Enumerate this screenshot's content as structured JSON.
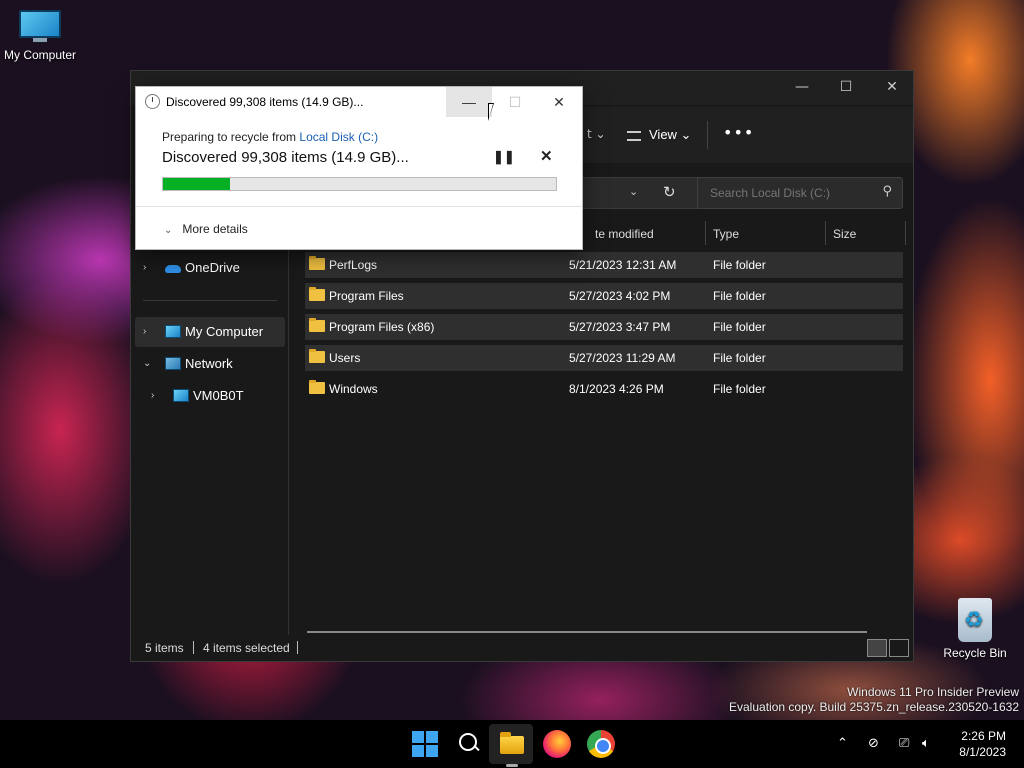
{
  "desktop": {
    "icons": [
      {
        "label": "My Computer",
        "icon": "computer-icon"
      },
      {
        "label": "Recycle Bin",
        "icon": "recycle-bin-icon"
      }
    ],
    "watermark": {
      "line1": "Windows 11 Pro Insider Preview",
      "line2": "Evaluation copy. Build 25375.zn_release.230520-1632"
    }
  },
  "explorer": {
    "toolbar": {
      "partial": "t ⌄",
      "view_label": "View ⌄",
      "more_label": "•••"
    },
    "search": {
      "placeholder": "Search Local Disk (C:)"
    },
    "columns": {
      "date": "te modified",
      "type": "Type",
      "size": "Size"
    },
    "nav": [
      {
        "label": "OneDrive",
        "chevron": "›",
        "icon": "onedrive-icon"
      },
      {
        "label": "My Computer",
        "chevron": "›",
        "icon": "computer-icon",
        "selected": true
      },
      {
        "label": "Network",
        "chevron": "⌄",
        "icon": "network-icon"
      },
      {
        "label": "VM0B0T",
        "chevron": "›",
        "icon": "computer-icon"
      }
    ],
    "files": [
      {
        "name": "PerfLogs",
        "date": "5/21/2023 12:31 AM",
        "type": "File folder",
        "selected": true
      },
      {
        "name": "Program Files",
        "date": "5/27/2023 4:02 PM",
        "type": "File folder",
        "selected": true
      },
      {
        "name": "Program Files (x86)",
        "date": "5/27/2023 3:47 PM",
        "type": "File folder",
        "selected": true
      },
      {
        "name": "Users",
        "date": "5/27/2023 11:29 AM",
        "type": "File folder",
        "selected": true
      },
      {
        "name": "Windows",
        "date": "8/1/2023 4:26 PM",
        "type": "File folder",
        "selected": false
      }
    ],
    "status": {
      "count": "5 items",
      "selected": "4 items selected"
    },
    "window_controls": {
      "minimize": "—",
      "maximize": "☐",
      "close": "✕"
    }
  },
  "dialog": {
    "title": "Discovered 99,308 items (14.9 GB)...",
    "preparing_prefix": "Preparing to recycle from ",
    "preparing_link": "Local Disk (C:)",
    "status": "Discovered 99,308 items (14.9 GB)...",
    "progress_fraction": 0.17,
    "progress_color": "#06b025",
    "pause_label": "❚❚",
    "cancel_label": "✕",
    "more_details": "More details",
    "more_chevron": "⌄",
    "controls": {
      "minimize": "—",
      "maximize": "☐",
      "close": "✕"
    }
  },
  "taskbar": {
    "clock_time": "2:26 PM",
    "clock_date": "8/1/2023",
    "tray": {
      "chevron": "⌃",
      "network": "⊘",
      "display": "⎚",
      "volume": "🔈︎"
    }
  }
}
